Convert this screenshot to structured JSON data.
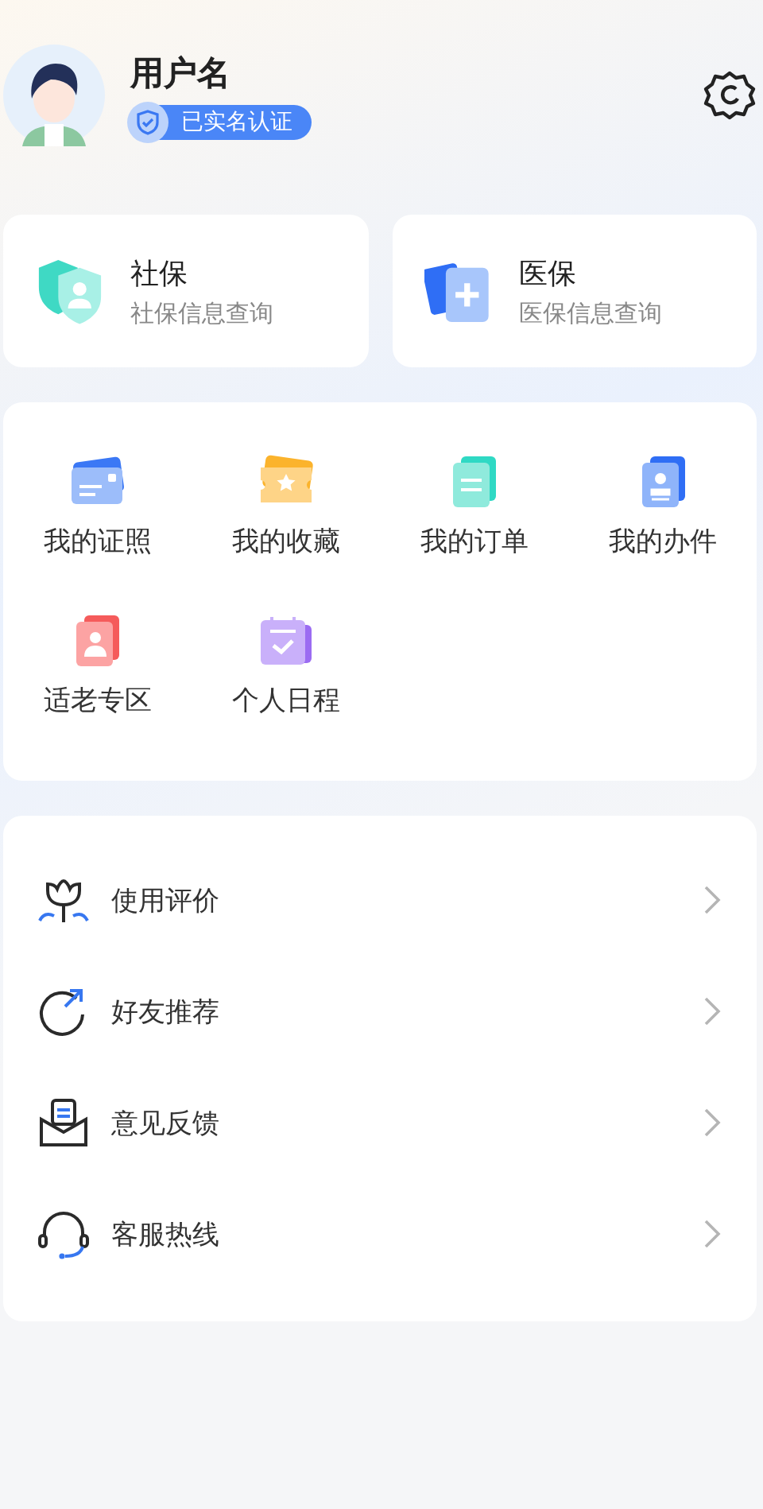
{
  "profile": {
    "username": "用户名",
    "verified": true,
    "badge": "已实名认证"
  },
  "cards": [
    {
      "kind": "social",
      "title": "社保",
      "subtitle": "社保信息查询"
    },
    {
      "kind": "medical",
      "title": "医保",
      "subtitle": "医保信息查询"
    }
  ],
  "shortcuts": [
    {
      "kind": "license",
      "label": "我的证照"
    },
    {
      "kind": "favorite",
      "label": "我的收藏"
    },
    {
      "kind": "order",
      "label": "我的订单"
    },
    {
      "kind": "affair",
      "label": "我的办件"
    },
    {
      "kind": "elder",
      "label": "适老专区"
    },
    {
      "kind": "schedule",
      "label": "个人日程"
    }
  ],
  "menu": [
    {
      "kind": "rate",
      "label": "使用评价"
    },
    {
      "kind": "share",
      "label": "好友推荐"
    },
    {
      "kind": "feedback",
      "label": "意见反馈"
    },
    {
      "kind": "hotline",
      "label": "客服热线"
    }
  ]
}
